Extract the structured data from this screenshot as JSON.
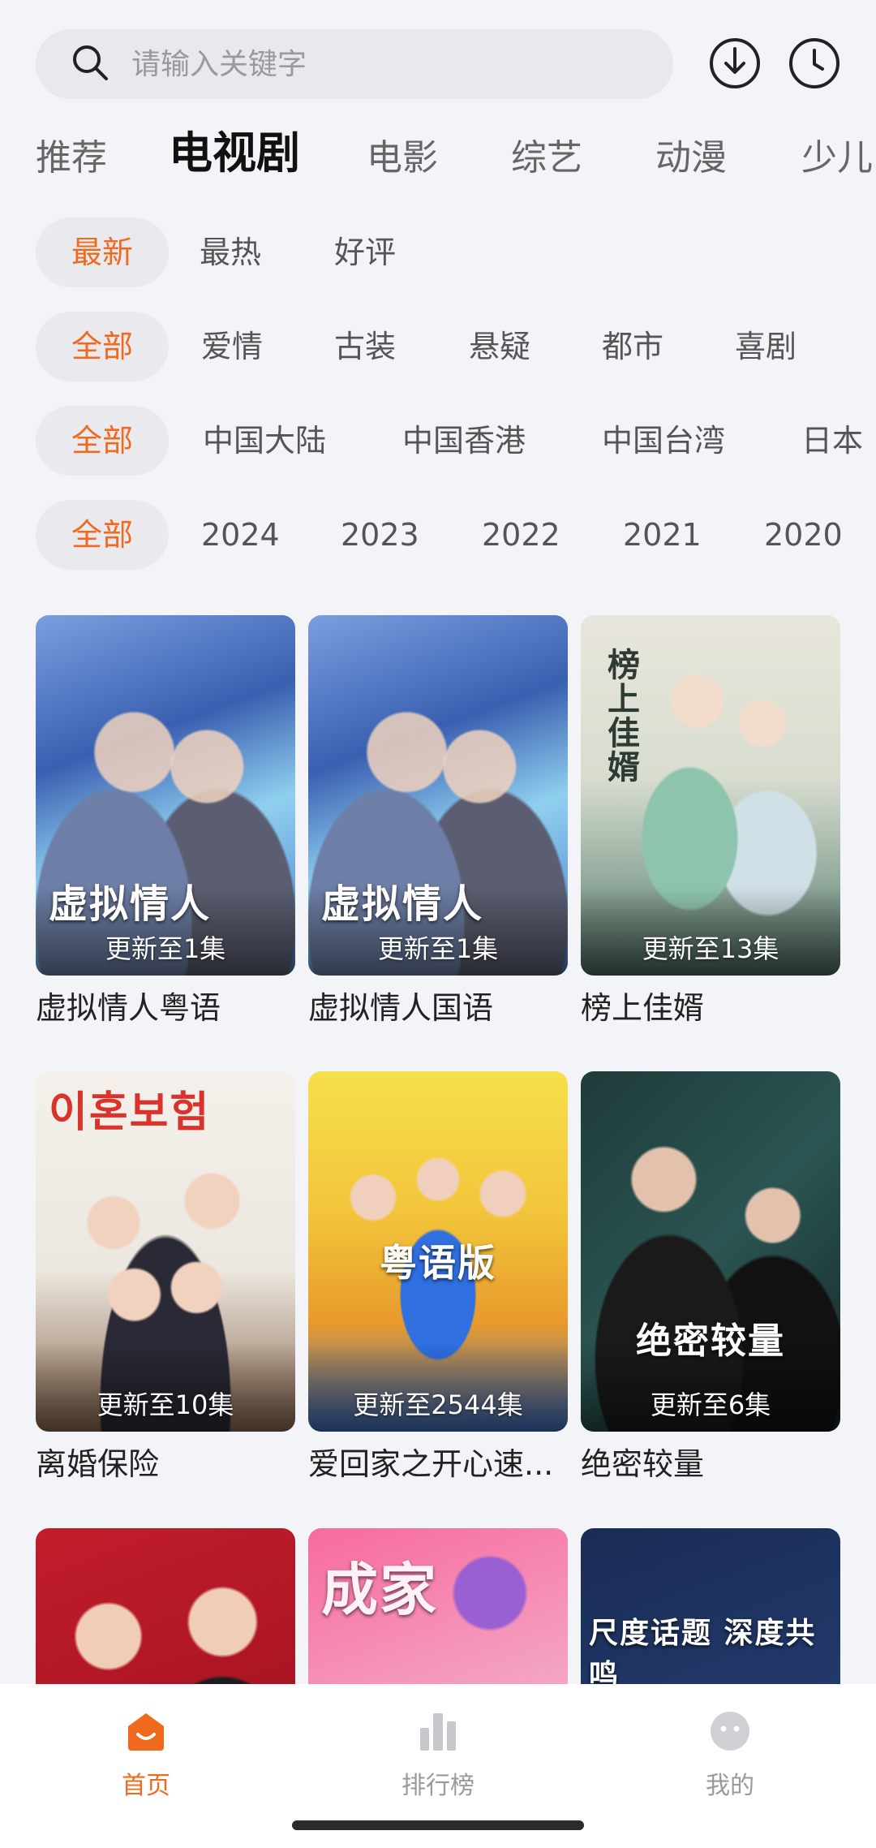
{
  "search": {
    "placeholder": "请输入关键字"
  },
  "header_icons": [
    "download-icon",
    "history-clock-icon"
  ],
  "categories": [
    {
      "label": "推荐",
      "active": false
    },
    {
      "label": "电视剧",
      "active": true
    },
    {
      "label": "电影",
      "active": false
    },
    {
      "label": "综艺",
      "active": false
    },
    {
      "label": "动漫",
      "active": false
    },
    {
      "label": "少儿",
      "active": false
    }
  ],
  "filters": {
    "sort": [
      "最新",
      "最热",
      "好评"
    ],
    "genre": [
      "全部",
      "爱情",
      "古装",
      "悬疑",
      "都市",
      "喜剧"
    ],
    "region": [
      "全部",
      "中国大陆",
      "中国香港",
      "中国台湾",
      "日本"
    ],
    "year": [
      "全部",
      "2024",
      "2023",
      "2022",
      "2021",
      "2020"
    ]
  },
  "cards": [
    {
      "title": "虚拟情人粤语",
      "episode": "更新至1集",
      "poster_text": "虚拟情人"
    },
    {
      "title": "虚拟情人国语",
      "episode": "更新至1集",
      "poster_text": "虚拟情人"
    },
    {
      "title": "榜上佳婿",
      "episode": "更新至13集",
      "poster_text": "榜上佳婿"
    },
    {
      "title": "离婚保险",
      "episode": "更新至10集",
      "poster_text": "이혼보험"
    },
    {
      "title": "爱回家之开心速...",
      "episode": "更新至2544集",
      "poster_text": "粤语版"
    },
    {
      "title": "绝密较量",
      "episode": "更新至6集",
      "poster_text": "绝密较量"
    },
    {
      "title": "",
      "episode": "",
      "poster_text": ""
    },
    {
      "title": "",
      "episode": "",
      "poster_text": "成家"
    },
    {
      "title": "",
      "episode": "",
      "poster_text": "尺度话题 深度共鸣"
    }
  ],
  "bottom_nav": [
    {
      "label": "首页",
      "icon": "home-icon",
      "active": true
    },
    {
      "label": "排行榜",
      "icon": "ranking-bar-icon",
      "active": false
    },
    {
      "label": "我的",
      "icon": "profile-icon",
      "active": false
    }
  ],
  "colors": {
    "accent": "#f06a1e",
    "background": "#f3f4f8"
  }
}
